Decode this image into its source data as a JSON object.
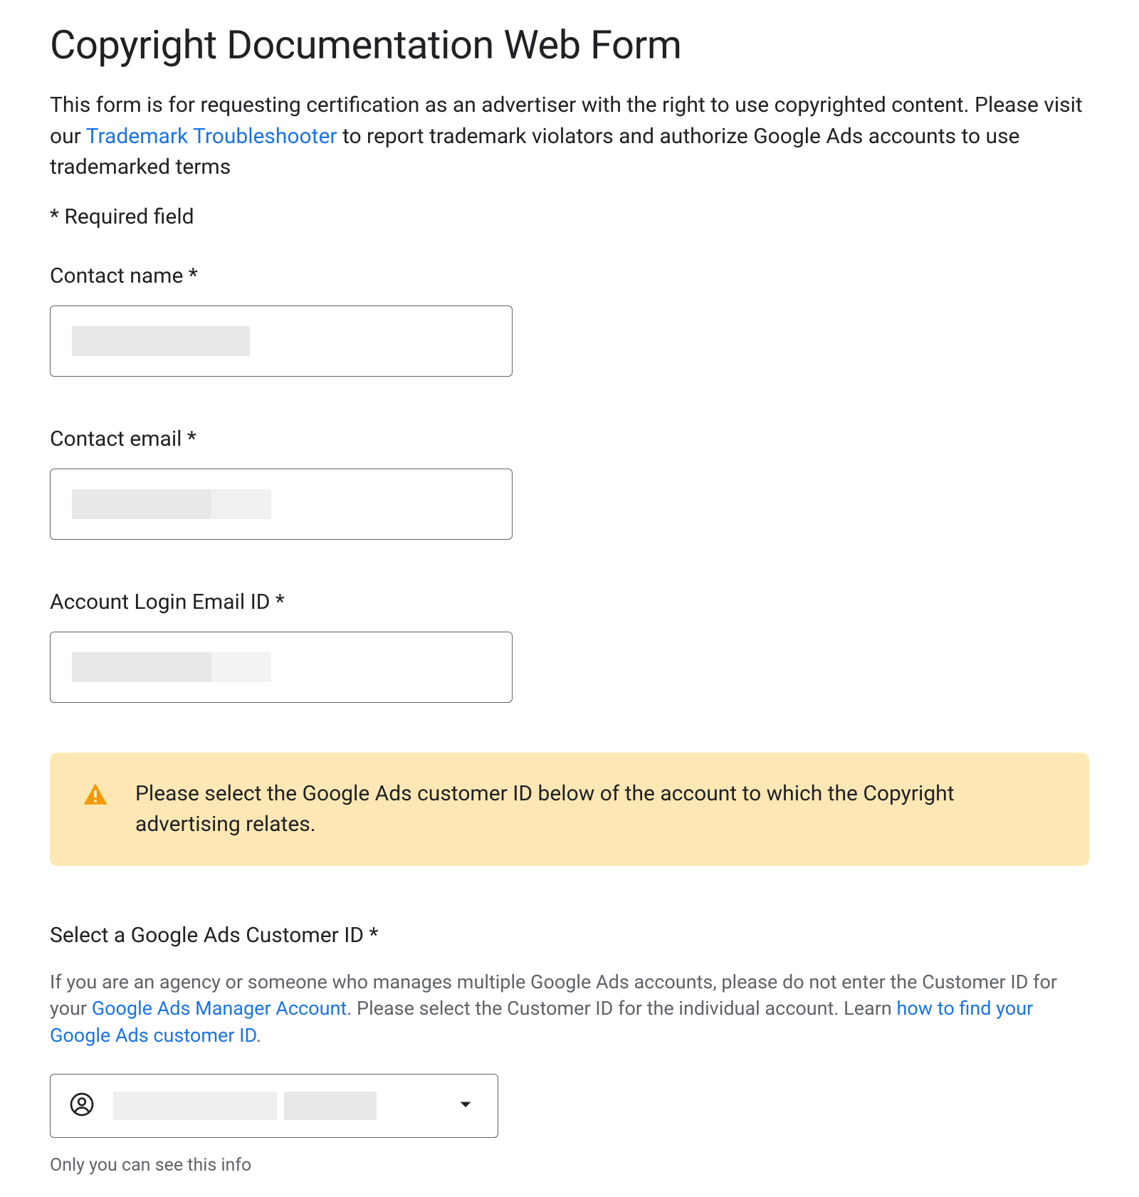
{
  "page": {
    "title": "Copyright Documentation Web Form",
    "intro_part1": "This form is for requesting certification as an advertiser with the right to use copyrighted content. Please visit our ",
    "intro_link1_text": "Trademark Troubleshooter",
    "intro_part2": " to report trademark violators and authorize Google Ads accounts to use trademarked terms",
    "required_note": "* Required field"
  },
  "fields": {
    "contact_name": {
      "label": "Contact name *",
      "value": ""
    },
    "contact_email": {
      "label": "Contact email *",
      "value": ""
    },
    "account_login_email": {
      "label": "Account Login Email ID *",
      "value": ""
    }
  },
  "alert": {
    "text": "Please select the Google Ads customer ID below of the account to which the Copyright advertising relates."
  },
  "customer_id_section": {
    "label": "Select a Google Ads Customer ID *",
    "helper_part1": "If you are an agency or someone who manages multiple Google Ads accounts, please do not enter the Customer ID for your ",
    "helper_link1_text": "Google Ads Manager Account",
    "helper_part2": ". Please select the Customer ID for the individual account. Learn ",
    "helper_link2_text": "how to find your Google Ads customer ID",
    "helper_part3": ".",
    "selected_value": "",
    "privacy_note": "Only you can see this info"
  },
  "colors": {
    "link": "#1a73e8",
    "text": "#202124",
    "muted": "#5f6368",
    "alert_bg": "#fde8b5",
    "alert_icon": "#f29900"
  }
}
